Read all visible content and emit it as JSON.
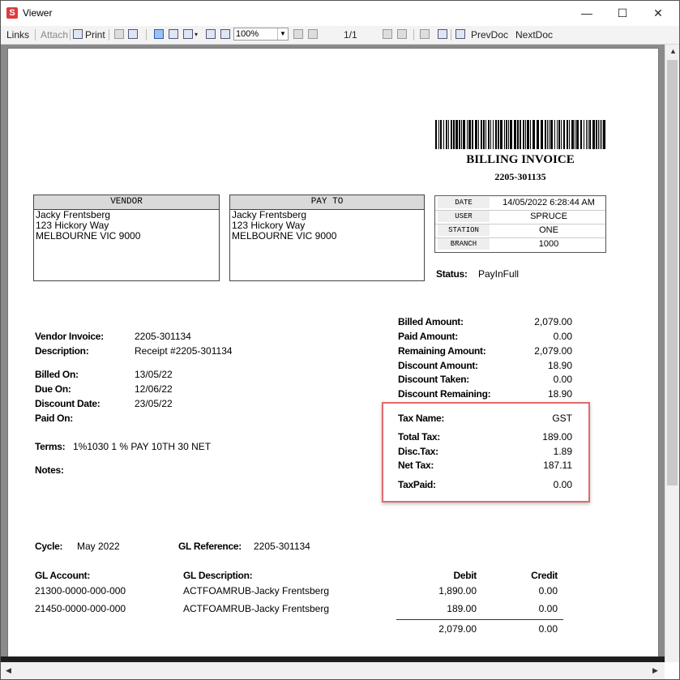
{
  "window": {
    "title": "Viewer",
    "app_icon": "S",
    "min": "—",
    "max": "☐",
    "close": "✕"
  },
  "toolbar": {
    "links": "Links",
    "attach": "Attach",
    "print": "Print",
    "zoom": "100%",
    "page_indicator": "1/1",
    "prev_doc": "PrevDoc",
    "next_doc": "NextDoc"
  },
  "invoice": {
    "title": "BILLING INVOICE",
    "number": "2205-301135",
    "vendor_box": {
      "header": "VENDOR",
      "lines": [
        "Jacky Frentsberg",
        "123 Hickory Way",
        "MELBOURNE VIC 9000"
      ]
    },
    "payto_box": {
      "header": "PAY TO",
      "lines": [
        "Jacky Frentsberg",
        "123 Hickory Way",
        "MELBOURNE VIC 9000"
      ]
    },
    "info": [
      {
        "key": "DATE",
        "value": "14/05/2022 6:28:44 AM"
      },
      {
        "key": "USER",
        "value": "SPRUCE"
      },
      {
        "key": "STATION",
        "value": "ONE"
      },
      {
        "key": "BRANCH",
        "value": "1000"
      }
    ],
    "status_label": "Status:",
    "status_value": "PayInFull",
    "left_fields": [
      {
        "label": "Vendor Invoice:",
        "value": "2205-301134"
      },
      {
        "label": "Description:",
        "value": "Receipt #2205-301134"
      },
      {
        "label": "Billed On:",
        "value": "13/05/22"
      },
      {
        "label": "Due On:",
        "value": "12/06/22"
      },
      {
        "label": "Discount Date:",
        "value": "23/05/22"
      },
      {
        "label": "Paid On:",
        "value": ""
      }
    ],
    "terms_label": "Terms:",
    "terms_value": "1%1030 1 % PAY 10TH 30 NET",
    "notes_label": "Notes:",
    "amounts": [
      {
        "label": "Billed Amount:",
        "value": "2,079.00"
      },
      {
        "label": "Paid Amount:",
        "value": "0.00"
      },
      {
        "label": "Remaining Amount:",
        "value": "2,079.00"
      },
      {
        "label": "Discount Amount:",
        "value": "18.90"
      },
      {
        "label": "Discount Taken:",
        "value": "0.00"
      },
      {
        "label": "Discount Remaining:",
        "value": "18.90"
      }
    ],
    "tax": [
      {
        "label": "Tax Name:",
        "value": "GST"
      },
      {
        "label": "Total Tax:",
        "value": "189.00"
      },
      {
        "label": "Disc.Tax:",
        "value": "1.89"
      },
      {
        "label": "Net Tax:",
        "value": "187.11"
      },
      {
        "label": "TaxPaid:",
        "value": "0.00"
      }
    ],
    "cycle_label": "Cycle:",
    "cycle_value": "May 2022",
    "glref_label": "GL Reference:",
    "glref_value": "2205-301134",
    "gl_headers": {
      "account": "GL Account:",
      "description": "GL Description:",
      "debit": "Debit",
      "credit": "Credit"
    },
    "gl_rows": [
      {
        "account": "21300-0000-000-000",
        "description": "ACTFOAMRUB-Jacky Frentsberg",
        "debit": "1,890.00",
        "credit": "0.00"
      },
      {
        "account": "21450-0000-000-000",
        "description": "ACTFOAMRUB-Jacky Frentsberg",
        "debit": "189.00",
        "credit": "0.00"
      }
    ],
    "gl_totals": {
      "debit": "2,079.00",
      "credit": "0.00"
    }
  }
}
